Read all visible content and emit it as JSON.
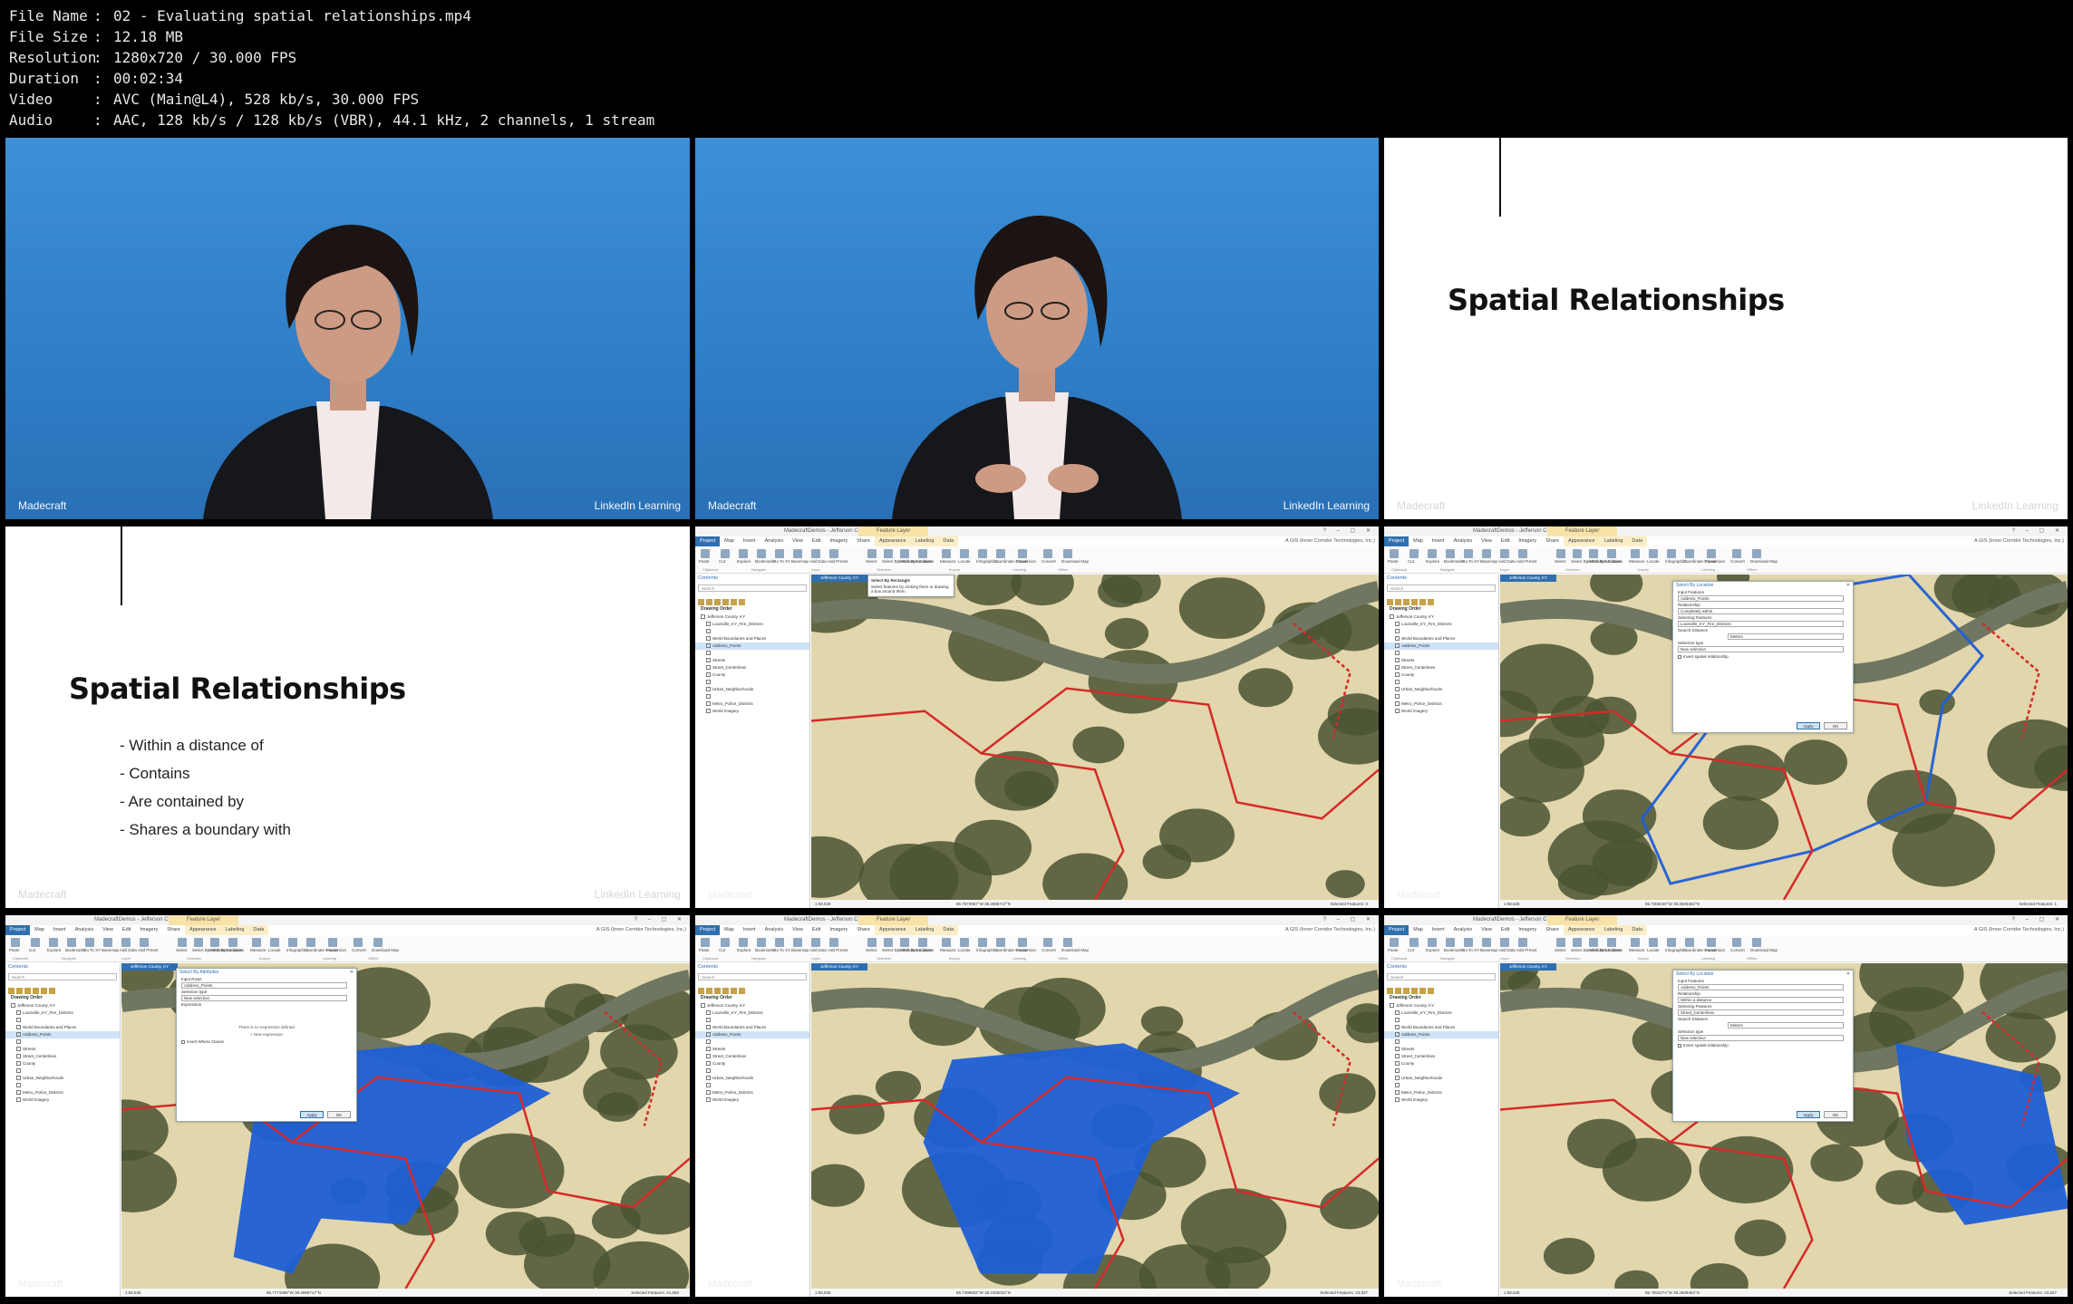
{
  "info": [
    {
      "key": "File Name",
      "value": "02 - Evaluating spatial relationships.mp4"
    },
    {
      "key": "File Size",
      "value": "12.18 MB"
    },
    {
      "key": "Resolution",
      "value": "1280x720 / 30.000 FPS"
    },
    {
      "key": "Duration",
      "value": "00:02:34"
    },
    {
      "key": "Video",
      "value": "AVC (Main@L4), 528 kb/s, 30.000 FPS"
    },
    {
      "key": "Audio",
      "value": "AAC, 128 kb/s / 128 kb/s (VBR), 44.1 kHz, 2 channels, 1 stream"
    }
  ],
  "info_separator": ":",
  "watermark": {
    "madecraft": "Madecraft",
    "linkedin": "LinkedIn Learning"
  },
  "slide": {
    "title": "Spatial Relationships",
    "bullets": [
      "- Within a distance of",
      "- Contains",
      "- Are contained by",
      "- Shares a boundary with"
    ]
  },
  "app": {
    "title": "MadecraftDemos - Jefferson County, KY - ArcGIS Pro",
    "context_tab": "Feature Layer",
    "window_controls": "? – ▢ ✕",
    "tabs": [
      "Project",
      "Map",
      "Insert",
      "Analysis",
      "View",
      "Edit",
      "Imagery",
      "Share",
      "Appearance",
      "Labeling",
      "Data"
    ],
    "user": "A GIS (Inner Corridor Technologies, Inc.)",
    "ribbon_buttons": [
      "Paste",
      "Cut",
      "Explore",
      "Bookmarks",
      "Go To XY",
      "Basemap",
      "Add Data",
      "Add Preset",
      "Select",
      "Select By Attributes",
      "Select By Location",
      "Attributes",
      "Measure",
      "Locate",
      "Infographics",
      "Coordinate Conversion",
      "Pause",
      "Convert",
      "Download Map"
    ],
    "ribbon_groups": [
      "Clipboard",
      "Navigate",
      "Layer",
      "Selection",
      "Inquiry",
      "Labeling",
      "Offline"
    ],
    "contents": {
      "header": "Contents",
      "search_placeholder": "Search",
      "section": "Drawing Order",
      "layers": [
        "Jefferson County, KY",
        "Louisville_KY_Fire_Districts",
        "",
        "World Boundaries and Places",
        "Address_Points",
        "",
        "Streets",
        "Street_Centerlines",
        "County",
        "",
        "Urban_Neighborhoods",
        "",
        "Metro_Police_Districts",
        "World Imagery"
      ]
    },
    "map_tab": "Jefferson County, KY",
    "scale": "1:58,536",
    "coords": [
      "85.7572967°W 38.2886717°N",
      "85.7305440°W 38.2608464°N",
      "85.7771598°W 38.2886717°N",
      "85.7498602°W 38.2305033°N",
      "85.7652274°W 38.2608464°N"
    ],
    "selected": [
      "Selected Features: 0",
      "Selected Features: 1",
      "Selected Features: 21,660",
      "Selected Features: 23,827",
      "Selected Features: 23,827"
    ],
    "tooltip": {
      "title": "Select By Rectangle",
      "text": "Select features by clicking them or drawing a box around them."
    },
    "dialogs": {
      "location": {
        "title": "Select By Location",
        "input_features": "Input Features",
        "input_value": "Address_Points",
        "relationship": "Relationship",
        "relationship_value_a": "Completely within",
        "relationship_value_b": "Within a distance",
        "selecting_features": "Selecting Features",
        "selecting_value_a": "Louisville_KY_Fire_Districts",
        "selecting_value_b": "Street_Centerlines",
        "search_distance": "Search Distance",
        "distance_unit": "Meters",
        "selection_type": "Selection type",
        "selection_value": "New selection",
        "invert": "Invert spatial relationship",
        "apply": "Apply",
        "ok": "OK"
      },
      "attributes": {
        "title": "Select By Attributes",
        "input_rows": "Input Rows",
        "input_value": "Address_Points",
        "selection_type": "Selection type",
        "selection_value": "New selection",
        "expression": "Expression",
        "no_expression": "There is no expression defined",
        "new_expression": "+ New expression",
        "invert": "Invert Where Clause",
        "apply": "Apply",
        "ok": "OK"
      }
    }
  },
  "colors": {
    "presenter_bg": "#2f7fc9",
    "project_tab": "#2f6fb0",
    "selection_blue": "#1f5fd6",
    "district_red": "#d42a2a",
    "parcel": "#e2d6ac",
    "terrain": "#4a5433",
    "river": "#6f7661"
  }
}
